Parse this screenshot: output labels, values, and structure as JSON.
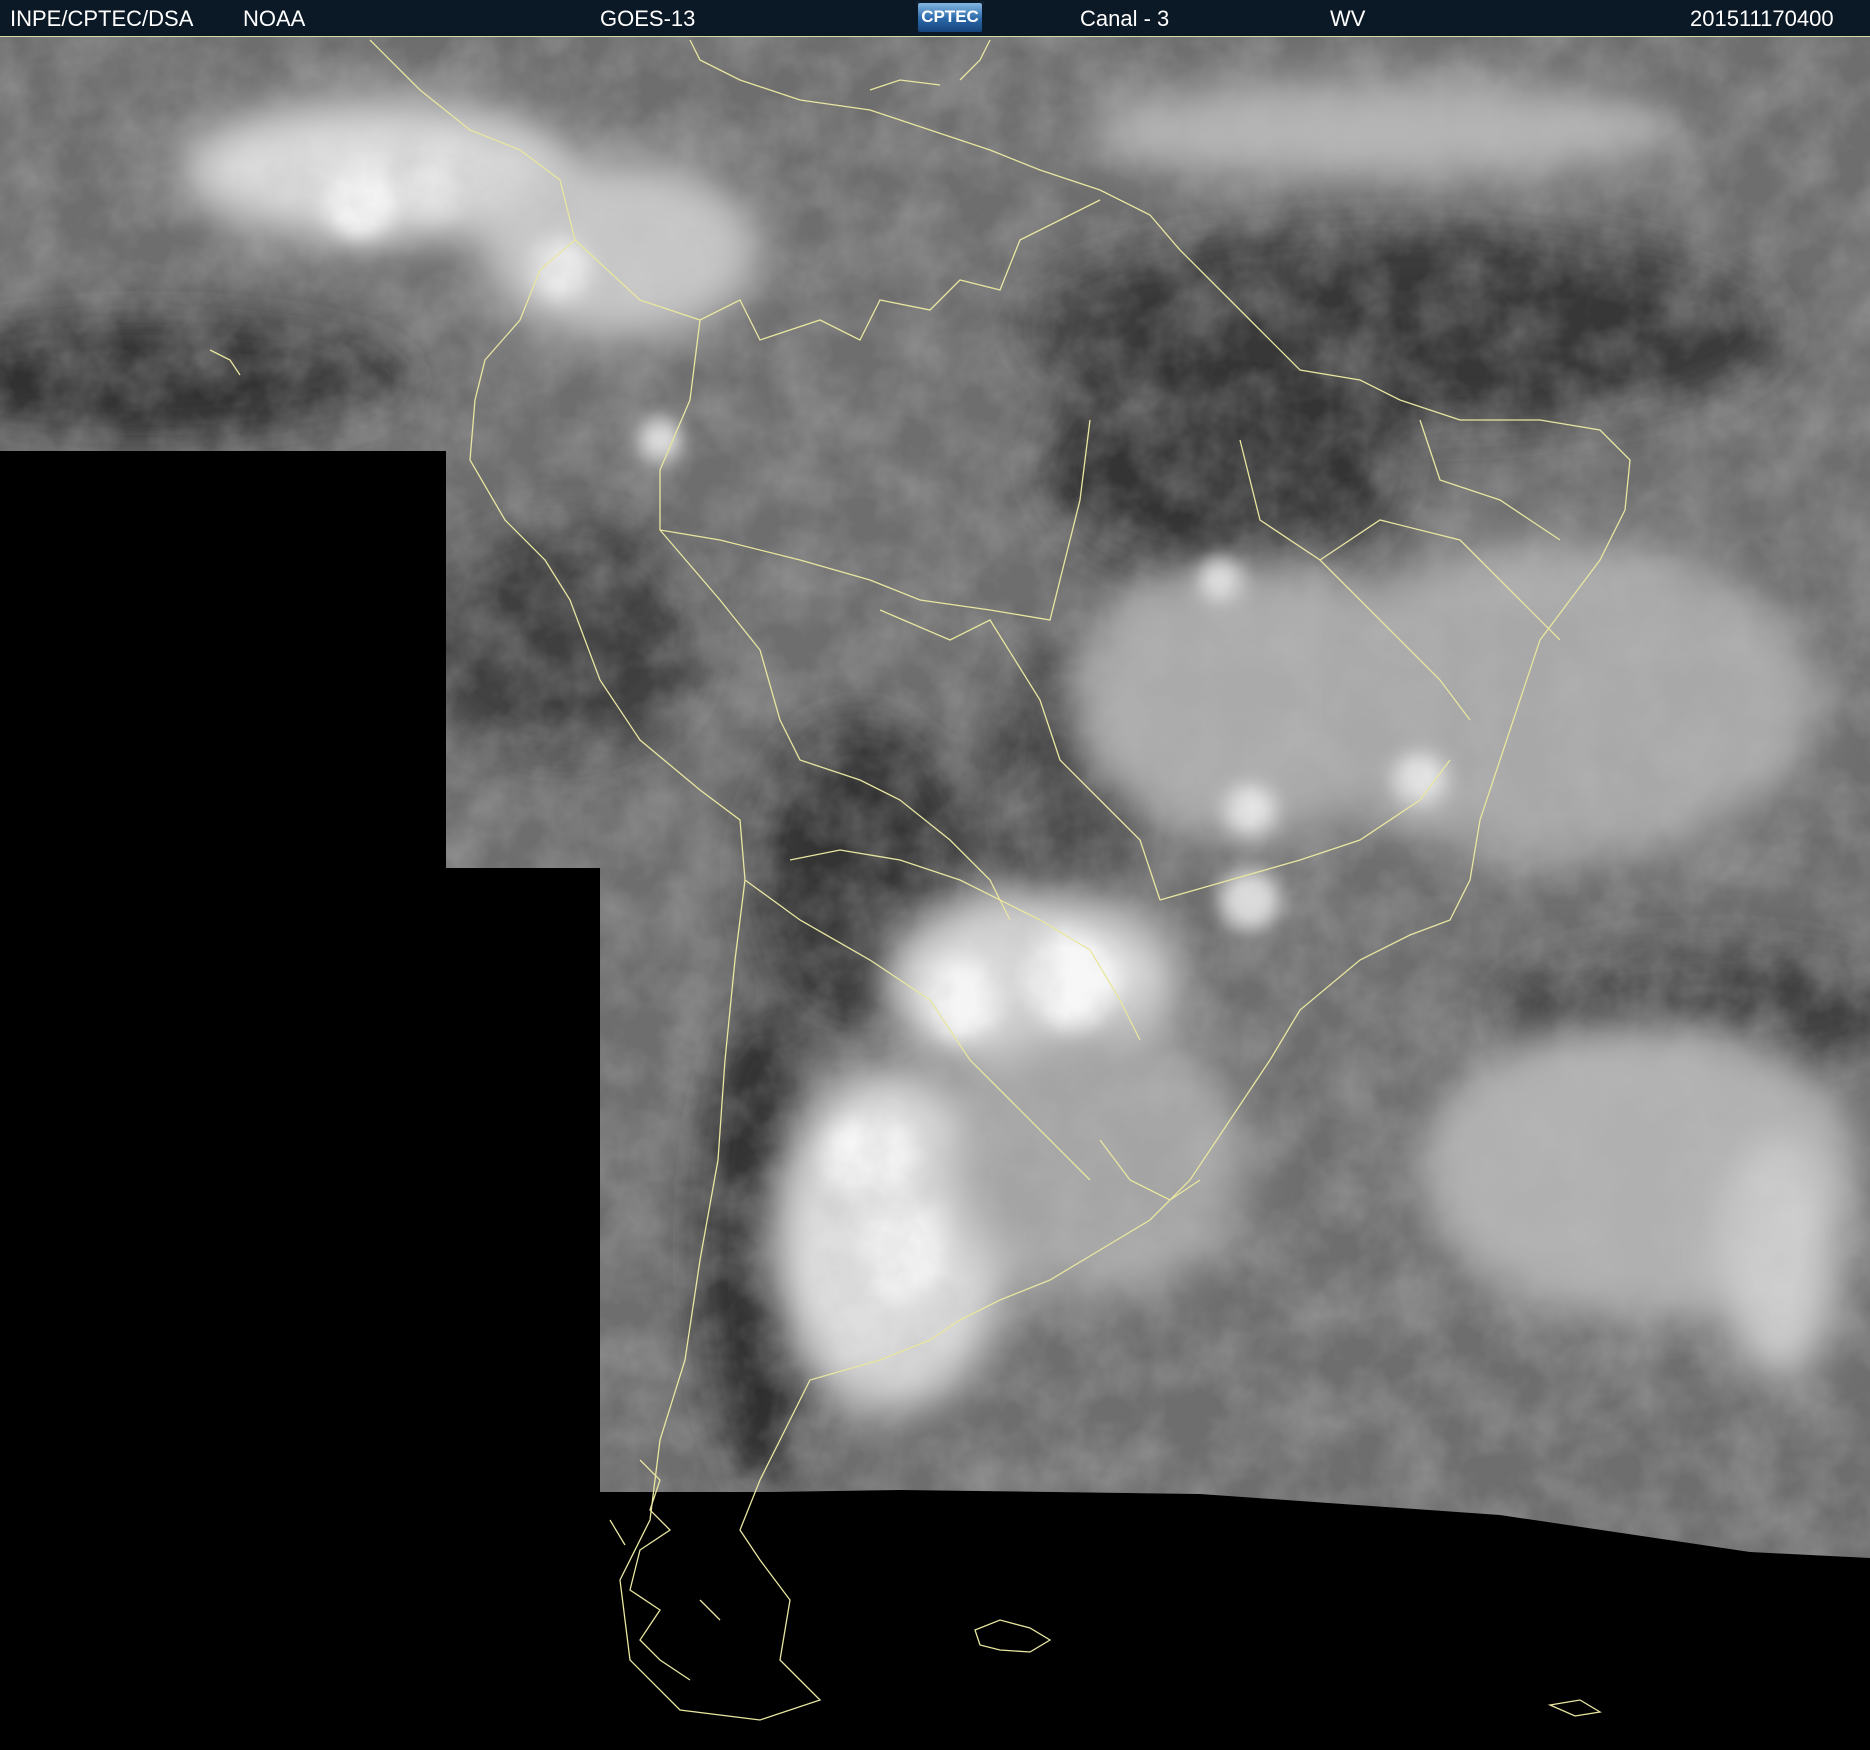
{
  "header": {
    "agency": "INPE/CPTEC/DSA",
    "partner": "NOAA",
    "satellite": "GOES-13",
    "logo": "CPTEC",
    "channel": "Canal - 3",
    "band": "WV",
    "timestamp": "201511170400"
  },
  "colors": {
    "header_bg": "#0b1826",
    "coastline": "#e8e6a0",
    "no_data": "#000000"
  }
}
